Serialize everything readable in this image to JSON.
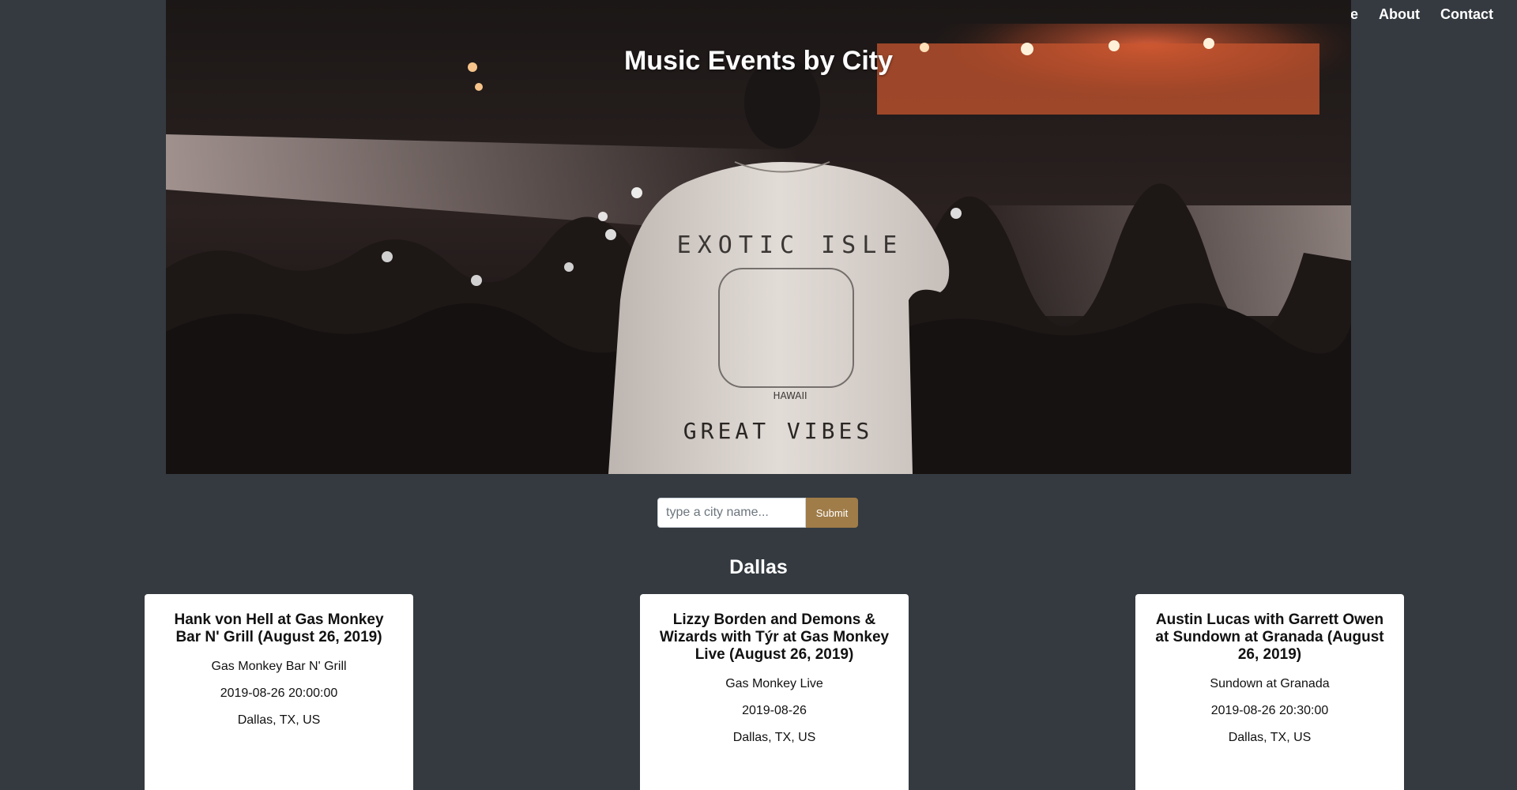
{
  "nav": {
    "items": [
      {
        "label": "Home"
      },
      {
        "label": "About"
      },
      {
        "label": "Contact"
      }
    ]
  },
  "hero": {
    "title": "Music Events by City",
    "shirt_top_text": "EXOTIC ISLE",
    "shirt_badge_text": "HAWAII",
    "shirt_bottom_text": "GREAT VIBES"
  },
  "search": {
    "placeholder": "type a city name...",
    "value": "",
    "submit_label": "Submit"
  },
  "results": {
    "city": "Dallas",
    "events": [
      {
        "title": "Hank von Hell at Gas Monkey Bar N' Grill (August 26, 2019)",
        "venue": "Gas Monkey Bar N' Grill",
        "datetime": "2019-08-26 20:00:00",
        "location": "Dallas, TX, US"
      },
      {
        "title": "Lizzy Borden and Demons & Wizards with Týr at Gas Monkey Live (August 26, 2019)",
        "venue": "Gas Monkey Live",
        "datetime": "2019-08-26",
        "location": "Dallas, TX, US"
      },
      {
        "title": "Austin Lucas with Garrett Owen at Sundown at Granada (August 26, 2019)",
        "venue": "Sundown at Granada",
        "datetime": "2019-08-26 20:30:00",
        "location": "Dallas, TX, US"
      }
    ]
  },
  "colors": {
    "page_background": "#343a40",
    "submit_button": "#a07c48",
    "card_background": "#ffffff"
  }
}
